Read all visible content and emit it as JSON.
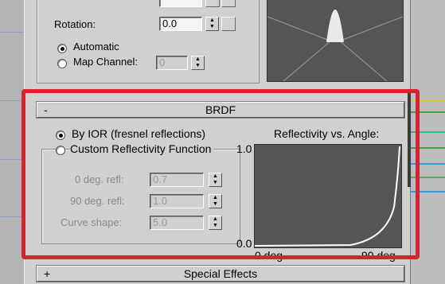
{
  "top_group": {
    "rotation_label": "Rotation:",
    "rotation_value": "0.0",
    "automatic_label": "Automatic",
    "map_channel_label": "Map Channel:",
    "map_channel_value": "0"
  },
  "brdf": {
    "collapse_sign": "-",
    "title": "BRDF",
    "by_ior_label": "By IOR (fresnel reflections)",
    "custom_label": "Custom Reflectivity Function",
    "graph_title": "Reflectivity vs. Angle:",
    "fields": [
      {
        "label": "0 deg. refl:",
        "value": "0.7"
      },
      {
        "label": "90 deg. refl:",
        "value": "1.0"
      },
      {
        "label": "Curve shape:",
        "value": "5.0"
      }
    ],
    "y_max": "1.0",
    "y_min": "0.0",
    "x_min": "0 deg",
    "x_max": "90 deg"
  },
  "special_effects": {
    "expand_sign": "+",
    "title": "Special Effects"
  },
  "colors": {
    "highlight": "#d4252d",
    "panel_bg": "#d0d0d0",
    "graph_bg": "#555555"
  }
}
